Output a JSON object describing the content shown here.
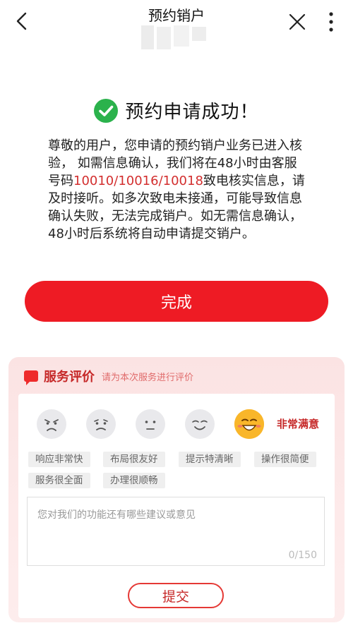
{
  "header": {
    "title": "预约销户"
  },
  "success": {
    "message": "预约申请成功！"
  },
  "notice": {
    "part1": "尊敬的用户，您申请的预约销户业务已进入核验， 如需信息确认，我们将在48小时由客服号码",
    "phones": "10010/10016/10018",
    "part2": "致电核实信息，请及时接听。如多次致电未接通，可能导致信息确认失败，无法完成销户。如无需信息确认，48小时后系统将自动申请提交销户。"
  },
  "done_button": "完成",
  "review": {
    "title": "服务评价",
    "subtitle": "请为本次服务进行评价",
    "rating_label": "非常满意",
    "tags": [
      "响应非常快",
      "布局很友好",
      "提示特清晰",
      "操作很简便",
      "服务很全面",
      "办理很顺畅"
    ],
    "placeholder": "您对我们的功能还有哪些建议或意见",
    "char_count": "0/150",
    "submit": "提交"
  },
  "colors": {
    "primary_red": "#ee1b24",
    "success_green": "#2bb24c"
  }
}
